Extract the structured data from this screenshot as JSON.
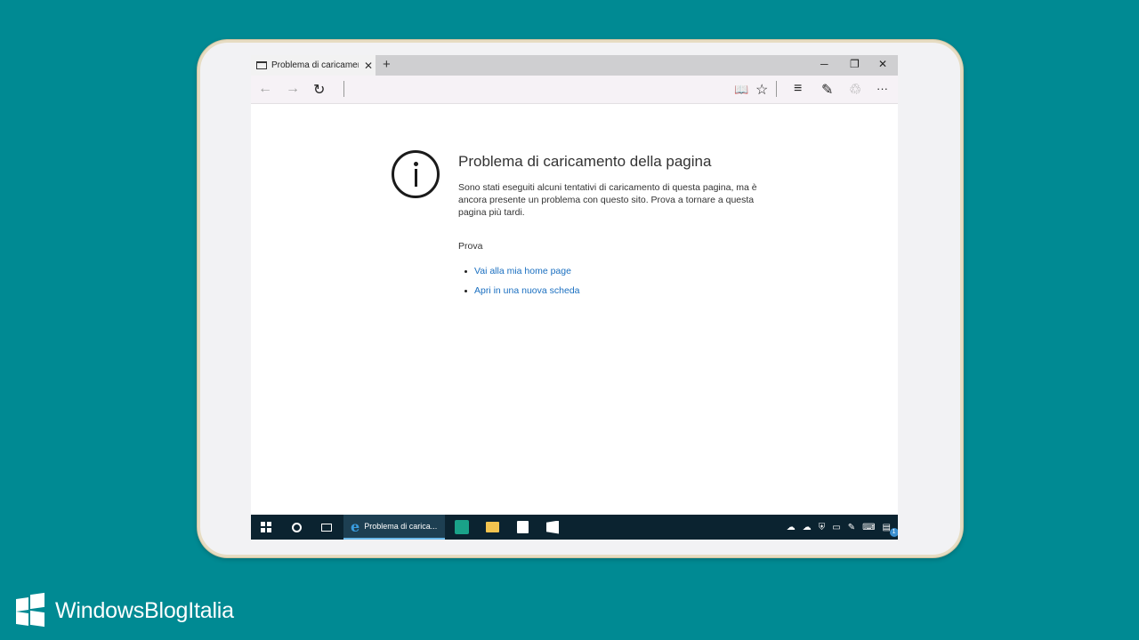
{
  "browser": {
    "tab_title": "Problema di caricament",
    "tab_close": "✕",
    "new_tab": "+",
    "minimize": "─",
    "restore": "❐",
    "close": "✕",
    "back": "←",
    "forward": "→",
    "refresh": "↻",
    "reading_view": "📖",
    "favorite": "☆",
    "hub": "≡",
    "web_note": "✎",
    "share": "♲",
    "more": "···"
  },
  "error_page": {
    "title": "Problema di caricamento della pagina",
    "description": "Sono stati eseguiti alcuni tentativi di caricamento di questa pagina, ma è ancora presente un problema con questo sito. Prova a tornare a questa pagina più tardi.",
    "try_label": "Prova",
    "links": [
      {
        "label": "Vai alla mia home page"
      },
      {
        "label": "Apri in una nuova scheda"
      }
    ]
  },
  "taskbar": {
    "active_app_title": "Problema di carica...",
    "notification_count": "1"
  },
  "brand": {
    "text": "WindowsBlogItalia"
  },
  "colors": {
    "background": "#008a93",
    "link": "#1a6fc0",
    "taskbar": "#0b2330"
  }
}
